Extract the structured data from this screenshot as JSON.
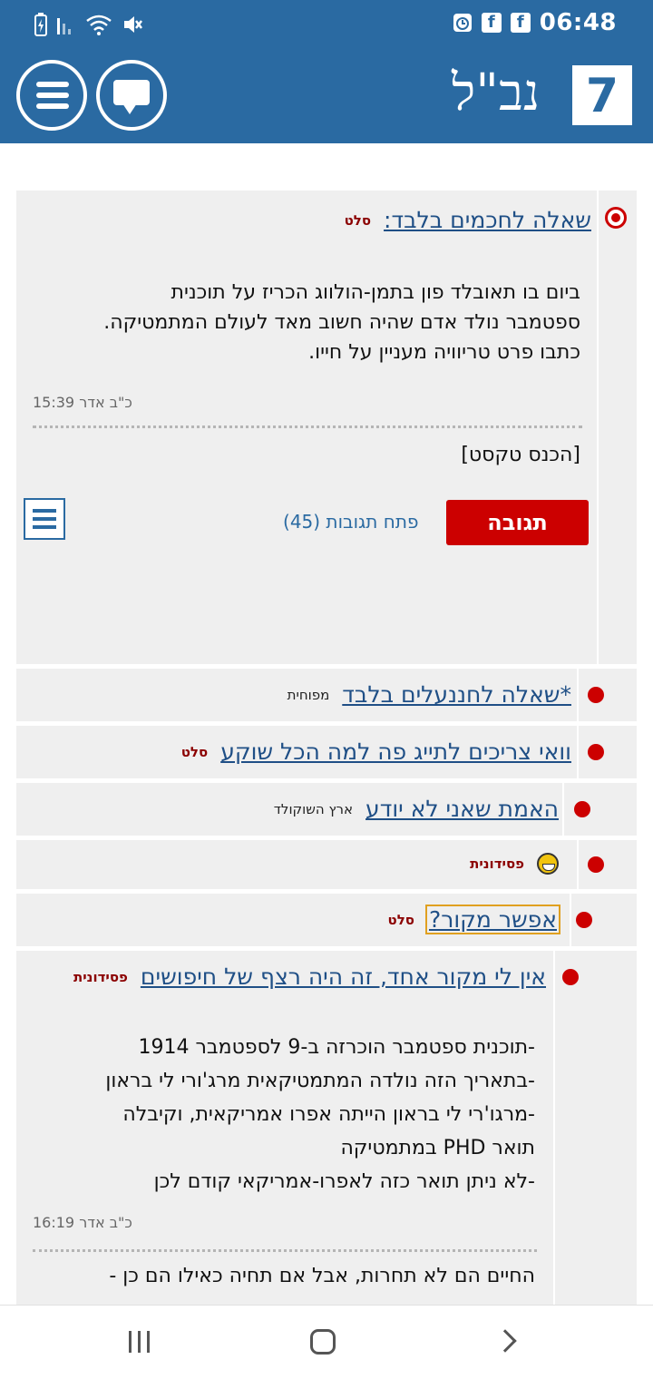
{
  "status_bar": {
    "time": "06:48",
    "left_icons": [
      "battery-saver-icon",
      "signal-icon",
      "wifi-icon",
      "mute-icon"
    ],
    "right_icons": [
      "alarm-icon",
      "facebook-icon",
      "facebook-icon"
    ]
  },
  "header": {
    "logo_number": "7",
    "logo_text": "נב\"ל",
    "menu_icon": "hamburger-icon",
    "chat_icon": "chat-icon"
  },
  "main_post": {
    "title": "שאלה לחכמים בלבד:",
    "author": "סלט",
    "body": [
      "ביום בו תאובלד פון בתמן-הולווג הכריז על תוכנית",
      "ספטמבר נולד אדם שהיה חשוב מאד לעולם המתמטיקה.",
      "כתבו פרט טריוויה מעניין על חייו."
    ],
    "timestamp": "כ\"ב אדר 15:39",
    "input_placeholder": "[הכנס טקסט]",
    "reply_label": "תגובה",
    "open_replies_label": "פתח תגובות (45)"
  },
  "replies": [
    {
      "title": "*שאלה לחננעלים בלבד",
      "author": "מפוחית",
      "author_style": "plain"
    },
    {
      "title": "וואי צריכים לתייג פה למה הכל שוקע",
      "author": "סלט",
      "author_style": "bold"
    },
    {
      "title": "האמת שאני לא יודע",
      "author": "ארץ השוקולד",
      "author_style": "plain"
    },
    {
      "title": "",
      "author": "פסידונית",
      "author_style": "bold",
      "icon": "laughing-smiley-icon"
    },
    {
      "title": "אפשר מקור?",
      "author": "סלט",
      "author_style": "bold"
    }
  ],
  "expanded_reply": {
    "title": "אין לי מקור אחד, זה היה רצף של חיפושים",
    "author": "פסידונית",
    "body": [
      "-תוכנית ספטמבר הוכרזה ב-9 לספטמבר 1914",
      "-בתאריך הזה נולדה המתמטיקאית מרג'ורי לי בראון",
      "-מרגו'רי לי בראון הייתה אפרו אמריקאית, וקיבלה",
      "תואר PHD במתמטיקה",
      "-לא ניתן תואר כזה לאפרו-אמריקאי קודם לכן"
    ],
    "timestamp": "כ\"ב אדר 16:19",
    "next_line": "החיים הם לא תחרות, אבל אם תחיה כאילו הם כן -"
  },
  "nav_bar": {
    "recent_icon": "recent-apps-icon",
    "home_icon": "home-icon",
    "back_icon": "back-icon"
  }
}
